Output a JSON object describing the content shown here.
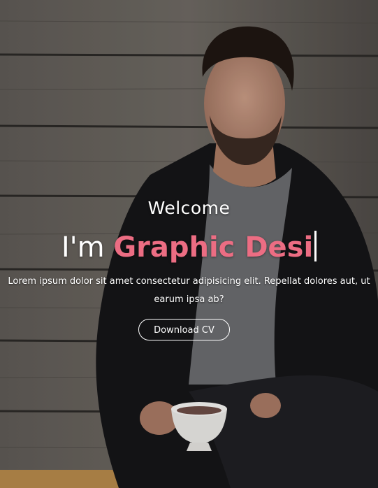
{
  "hero": {
    "welcome": "Welcome",
    "headline_prefix": "I'm ",
    "headline_typed": "Graphic Desi",
    "description": "Lorem ipsum dolor sit amet consectetur adipisicing elit. Repellat dolores aut, ut earum ipsa ab?",
    "button_label": "Download CV",
    "background_image": "man-with-coffee-cup-against-wooden-wall-photo"
  },
  "colors": {
    "accent": "#ec6d83",
    "text": "#ffffff"
  }
}
